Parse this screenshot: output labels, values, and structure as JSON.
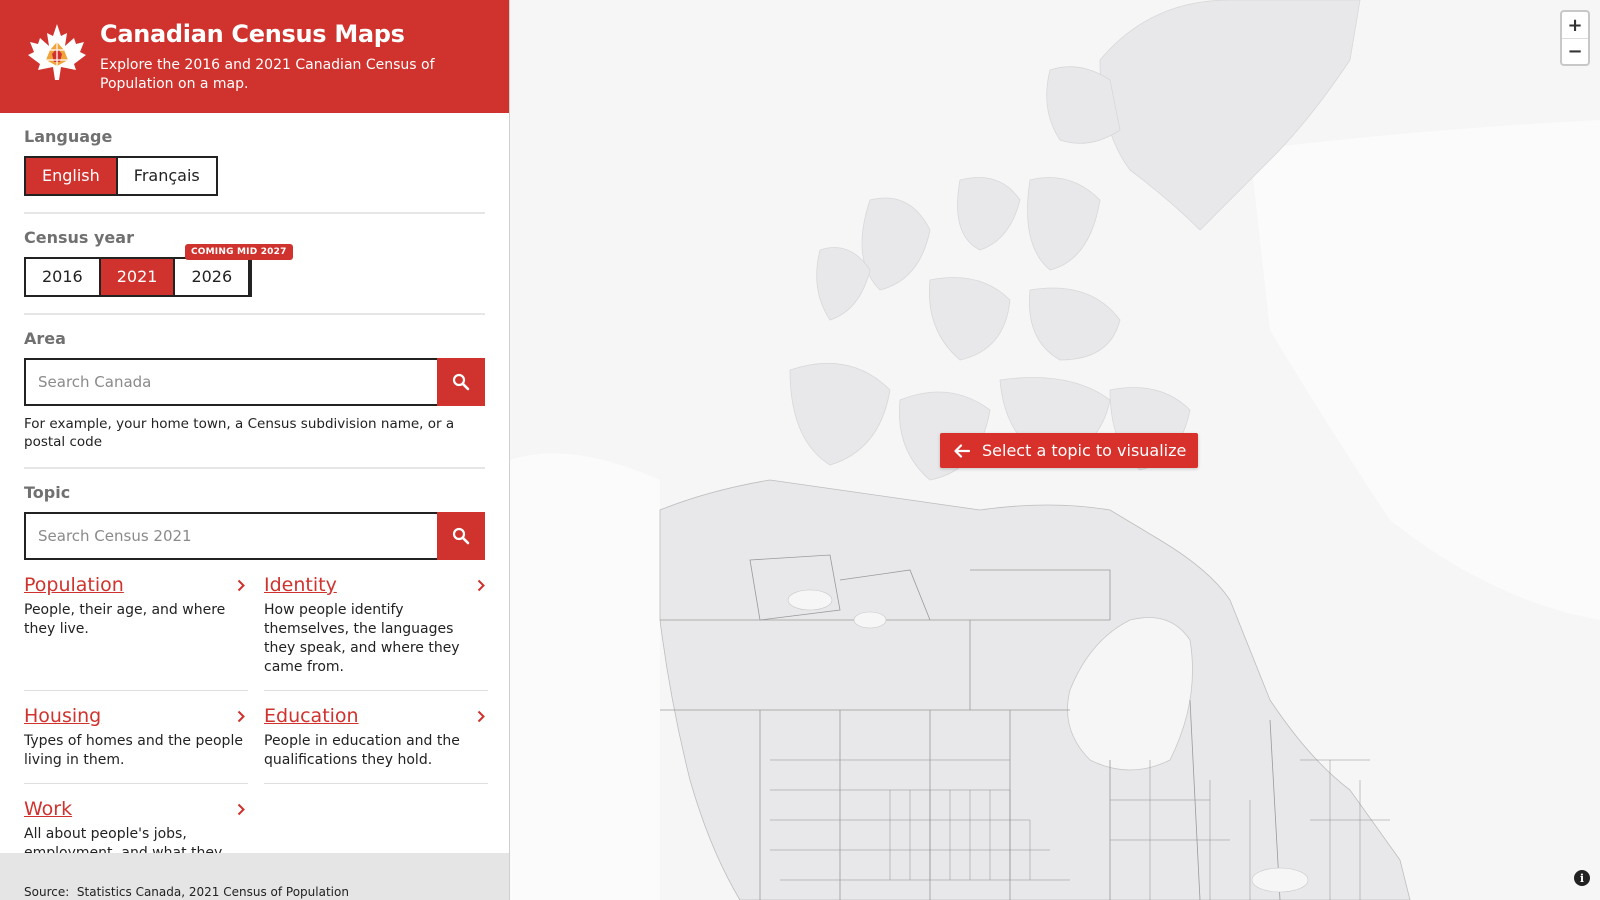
{
  "header": {
    "title": "Canadian Census Maps",
    "subtitle": "Explore the 2016 and 2021 Canadian Census of Population on a map.",
    "logo_icon": "maple-leaf-logo"
  },
  "language": {
    "label": "Language",
    "options": [
      "English",
      "Français"
    ],
    "selected": "English"
  },
  "census_year": {
    "label": "Census year",
    "options": [
      "2016",
      "2021",
      "2026"
    ],
    "selected": "2021",
    "badge": "COMING MID 2027"
  },
  "area": {
    "label": "Area",
    "placeholder": "Search Canada",
    "hint": "For example, your home town, a Census subdivision name, or a postal code"
  },
  "topic": {
    "label": "Topic",
    "placeholder": "Search Census 2021",
    "items": [
      {
        "title": "Population",
        "description": "People, their age, and where they live."
      },
      {
        "title": "Identity",
        "description": "How people identify themselves, the languages they speak, and where they came from."
      },
      {
        "title": "Housing",
        "description": "Types of homes and the people living in them."
      },
      {
        "title": "Education",
        "description": "People in education and the qualifications they hold."
      },
      {
        "title": "Work",
        "description": "All about people's jobs, employment, and what they earn."
      }
    ]
  },
  "footer": {
    "source_label": "Source:",
    "source_text": "Statistics Canada, 2021 Census of Population"
  },
  "map": {
    "cta": "Select a topic to visualize",
    "zoom_in": "+",
    "zoom_out": "−",
    "info": "i"
  },
  "colors": {
    "brand_red": "#d0322d",
    "land": "#e8e8ea",
    "water": "#f6f6f6"
  }
}
